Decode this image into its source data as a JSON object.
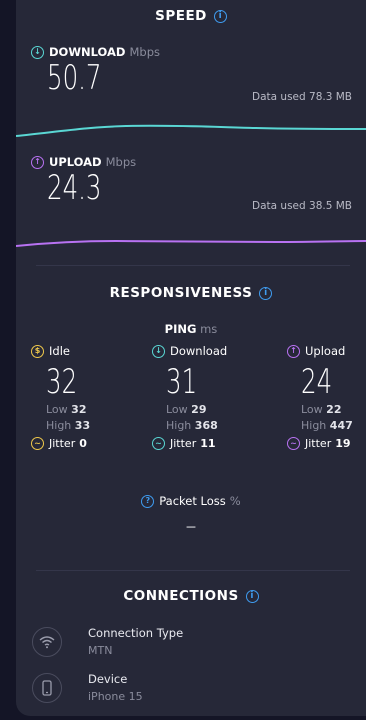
{
  "speed": {
    "title": "SPEED",
    "download": {
      "label": "DOWNLOAD",
      "unit": "Mbps",
      "value": "50.7",
      "data_used": "Data used 78.3 MB",
      "color": "#5ad7d4"
    },
    "upload": {
      "label": "UPLOAD",
      "unit": "Mbps",
      "value": "24.3",
      "data_used": "Data used 38.5 MB",
      "color": "#b872f2"
    }
  },
  "responsiveness": {
    "title": "RESPONSIVENESS",
    "ping_label": "PING",
    "ping_unit": "ms",
    "idle": {
      "label": "Idle",
      "value": "32",
      "low_label": "Low",
      "low": "32",
      "high_label": "High",
      "high": "33",
      "jitter_label": "Jitter",
      "jitter": "0",
      "color": "#f0c94b"
    },
    "download": {
      "label": "Download",
      "value": "31",
      "low_label": "Low",
      "low": "29",
      "high_label": "High",
      "high": "368",
      "jitter_label": "Jitter",
      "jitter": "11",
      "color": "#5ad7d4"
    },
    "upload": {
      "label": "Upload",
      "value": "24",
      "low_label": "Low",
      "low": "22",
      "high_label": "High",
      "high": "447",
      "jitter_label": "Jitter",
      "jitter": "19",
      "color": "#b872f2"
    },
    "packet_loss_label": "Packet Loss",
    "packet_loss_unit": "%",
    "packet_loss_value": "–"
  },
  "connections": {
    "title": "CONNECTIONS",
    "connection_type_label": "Connection Type",
    "connection_type_value": "MTN",
    "device_label": "Device",
    "device_value": "iPhone 15"
  }
}
